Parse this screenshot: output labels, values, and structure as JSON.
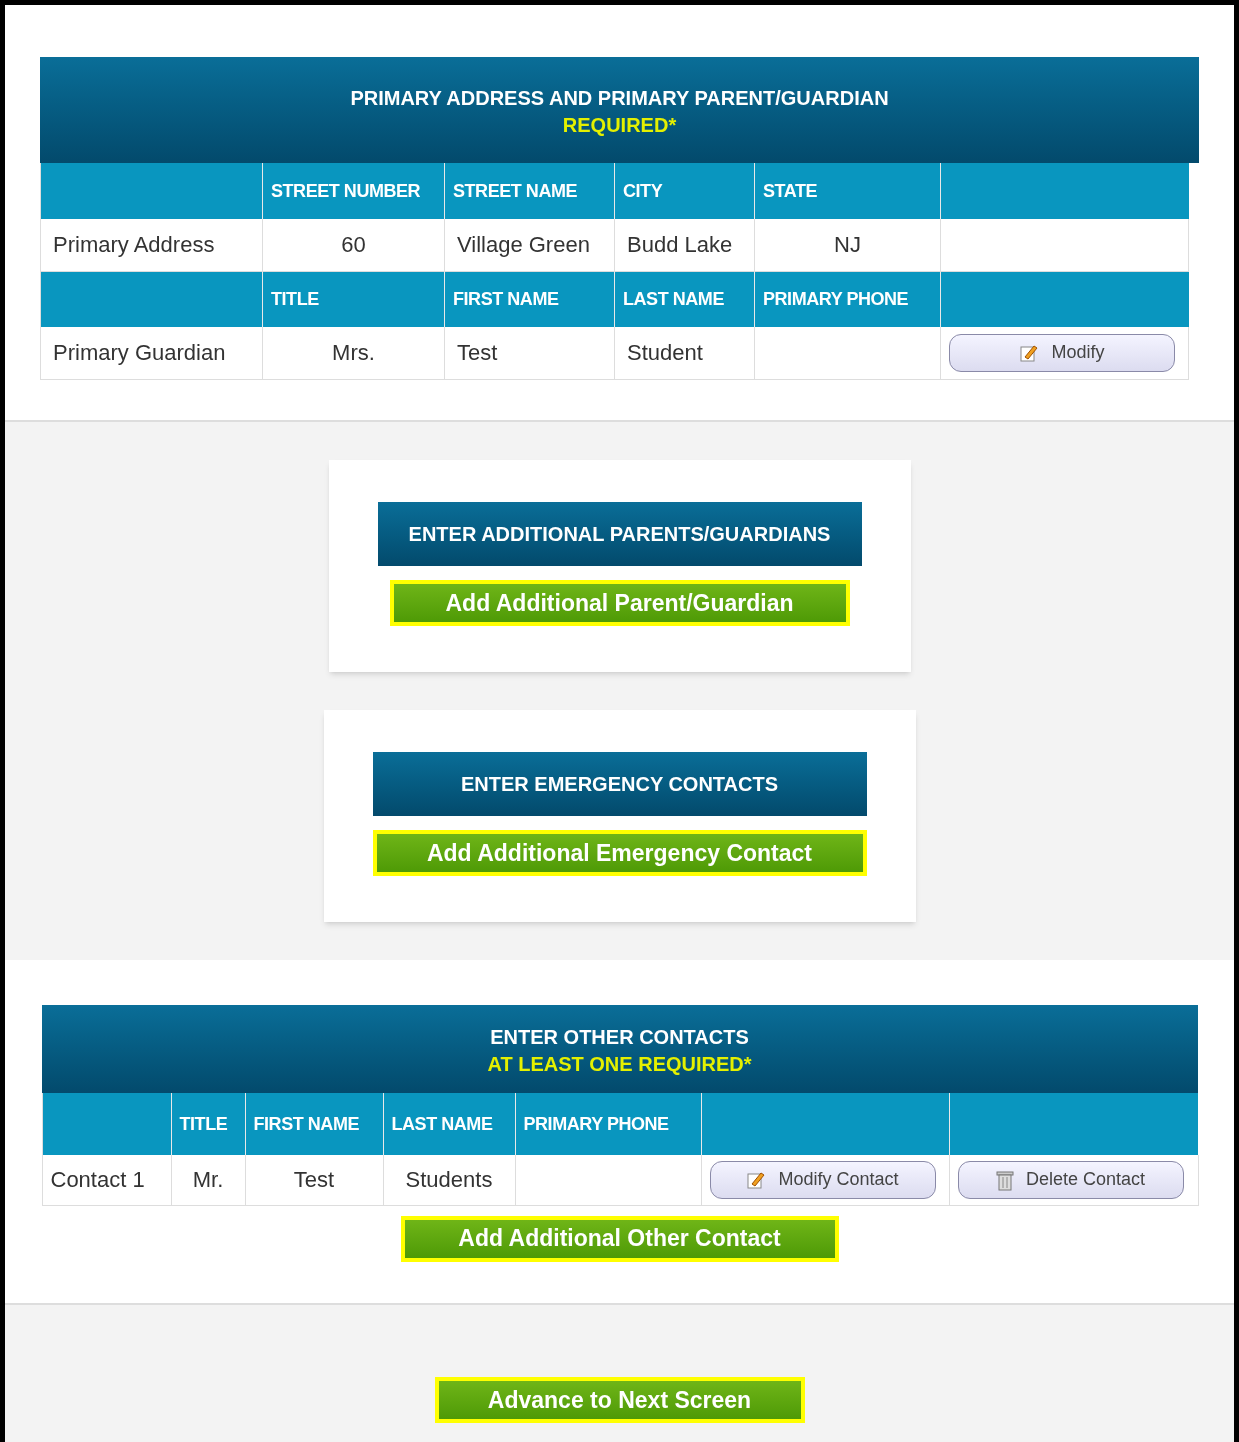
{
  "primary": {
    "title": "PRIMARY ADDRESS AND PRIMARY PARENT/GUARDIAN",
    "note": "REQUIRED*",
    "address_headers": [
      "STREET NUMBER",
      "STREET NAME",
      "CITY",
      "STATE"
    ],
    "address_row": {
      "label": "Primary Address",
      "cells": [
        "60",
        "Village Green",
        "Budd Lake",
        "NJ"
      ]
    },
    "guardian_headers": [
      "TITLE",
      "FIRST NAME",
      "LAST NAME",
      "PRIMARY PHONE"
    ],
    "guardian_row": {
      "label": "Primary Guardian",
      "cells": [
        "Mrs.",
        "Test",
        "Student"
      ],
      "action": "Modify"
    }
  },
  "cards": [
    {
      "title": "ENTER ADDITIONAL PARENTS/GUARDIANS",
      "button": "Add Additional Parent/Guardian",
      "highlighted": true
    },
    {
      "title": "ENTER EMERGENCY CONTACTS",
      "button": "Add Additional Emergency Contact",
      "highlighted": true
    }
  ],
  "other": {
    "title": "ENTER OTHER CONTACTS",
    "note": "AT LEAST ONE REQUIRED*",
    "headers": [
      "TITLE",
      "FIRST NAME",
      "LAST NAME",
      "PRIMARY PHONE"
    ],
    "rows": [
      {
        "label": "Contact 1",
        "cells": [
          "Mr.",
          "Test",
          "Students"
        ],
        "modify": "Modify Contact",
        "delete": "Delete Contact"
      }
    ],
    "button": "Add Additional Other Contact",
    "highlighted": true
  },
  "advance": {
    "button": "Advance to Next Screen",
    "highlighted": true
  }
}
